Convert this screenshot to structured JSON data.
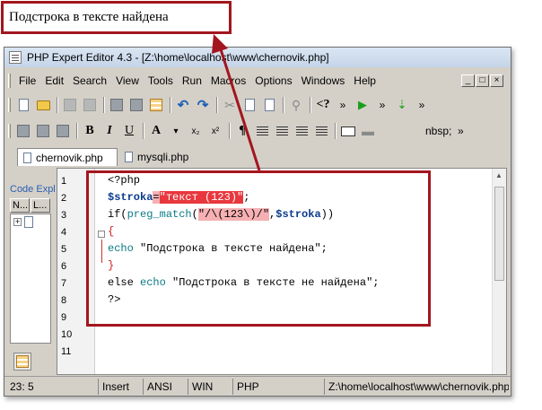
{
  "output": {
    "text": "Подстрока в тексте найдена"
  },
  "window": {
    "title": "PHP Expert Editor 4.3 - [Z:\\home\\localhost\\www\\chernovik.php]"
  },
  "menu": [
    "File",
    "Edit",
    "Search",
    "View",
    "Tools",
    "Run",
    "Macros",
    "Options",
    "Windows",
    "Help"
  ],
  "win_controls": [
    "_",
    "□",
    "×"
  ],
  "toolbar1": {
    "tag_button": "<?",
    "more": "»"
  },
  "toolbar2": {
    "bold": "B",
    "italic": "I",
    "underline": "U",
    "font": "A",
    "sub": "x₂",
    "sup": "x²",
    "para": "¶",
    "nbsp": "nbsp;",
    "more": "»"
  },
  "tabs": [
    {
      "label": "chernovik.php"
    },
    {
      "label": "mysqli.php"
    }
  ],
  "left_panel": {
    "title": "Code Explorer",
    "col1": "N...",
    "col2": "L...",
    "expand": "+"
  },
  "lines": [
    "1",
    "2",
    "3",
    "4",
    "5",
    "6",
    "7",
    "8",
    "9",
    "10",
    "11"
  ],
  "code": {
    "l1": "<?php",
    "l2_var": "$stroka",
    "l2_eq": "=",
    "l2_str": "\"текст (123)\"",
    "l2_end": ";",
    "l3_if": "if(",
    "l3_fn": "preg_match",
    "l3_open": "(",
    "l3_pattern": "\"/\\(123\\)/\"",
    "l3_comma": ",",
    "l3_var": "$stroka",
    "l3_close": "))",
    "l4": "{",
    "l5_kw": "echo",
    "l5_str": " \"Подстрока в тексте найдена\";",
    "l6": "}",
    "l7_else": "else",
    "l7_kw": " echo",
    "l7_str": " \"Подстрока в тексте не найдена\";",
    "l8": "?>"
  },
  "status": {
    "pos": "23: 5",
    "mode": "Insert",
    "enc": "ANSI",
    "os": "WIN",
    "lang": "PHP",
    "path": "Z:\\home\\localhost\\www\\chernovik.php"
  }
}
